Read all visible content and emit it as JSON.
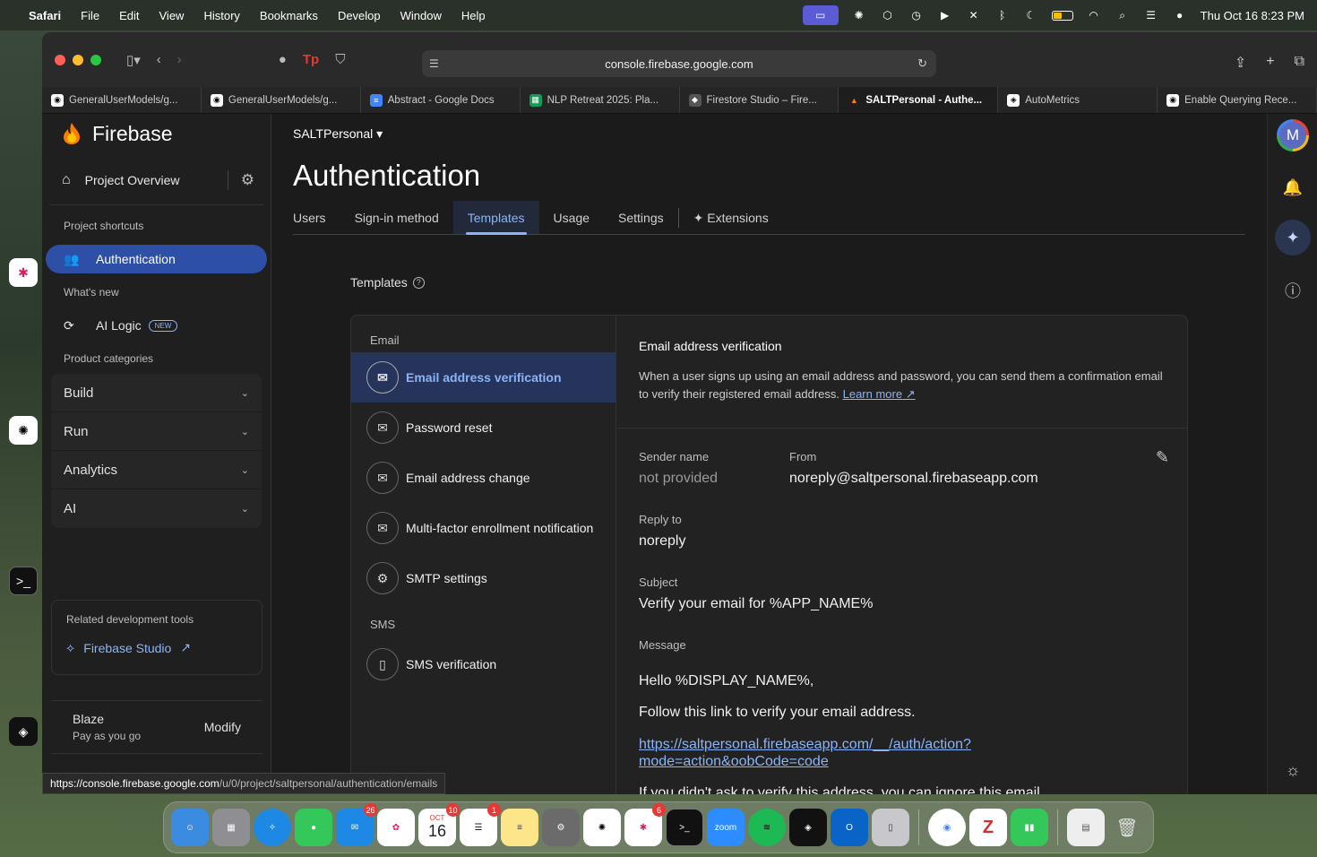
{
  "menubar": {
    "app_name": "Safari",
    "menus": [
      "File",
      "Edit",
      "View",
      "History",
      "Bookmarks",
      "Develop",
      "Window",
      "Help"
    ],
    "datetime": "Thu Oct 16  8:23 PM"
  },
  "browser": {
    "url": "console.firebase.google.com",
    "tabs": [
      {
        "label": "GeneralUserModels/g...",
        "icon": "github-icon"
      },
      {
        "label": "GeneralUserModels/g...",
        "icon": "github-icon"
      },
      {
        "label": "Abstract - Google Docs",
        "icon": "google-docs-icon"
      },
      {
        "label": "NLP Retreat 2025: Pla...",
        "icon": "google-sheets-icon"
      },
      {
        "label": "Firestore Studio – Fire...",
        "icon": "firebase-studio-icon"
      },
      {
        "label": "SALTPersonal - Authe...",
        "icon": "firebase-icon",
        "active": true
      },
      {
        "label": "AutoMetrics",
        "icon": "autometrics-icon"
      },
      {
        "label": "Enable Querying Rece...",
        "icon": "github-icon"
      }
    ],
    "status_url_prefix": "https://console.firebase.google.com",
    "status_url_rest": "/u/0/project/saltpersonal/authentication/emails"
  },
  "sidebar": {
    "brand": "Firebase",
    "project_overview": "Project Overview",
    "shortcuts_label": "Project shortcuts",
    "authentication": "Authentication",
    "whats_new_label": "What's new",
    "ai_logic": "AI Logic",
    "new_badge": "NEW",
    "categories_label": "Product categories",
    "categories": [
      "Build",
      "Run",
      "Analytics",
      "AI"
    ],
    "tools_label": "Related development tools",
    "firebase_studio": "Firebase Studio",
    "plan_name": "Blaze",
    "plan_desc": "Pay as you go",
    "modify": "Modify"
  },
  "main": {
    "project": "SALTPersonal",
    "title": "Authentication",
    "tabs": [
      "Users",
      "Sign-in method",
      "Templates",
      "Usage",
      "Settings",
      "Extensions"
    ],
    "active_tab": "Templates",
    "templates_heading": "Templates"
  },
  "templates": {
    "email_group": "Email",
    "email_items": [
      {
        "label": "Email address verification",
        "icon": "mail-icon"
      },
      {
        "label": "Password reset",
        "icon": "mail-icon"
      },
      {
        "label": "Email address change",
        "icon": "mail-icon"
      },
      {
        "label": "Multi-factor enrollment notification",
        "icon": "mail-icon"
      },
      {
        "label": "SMTP settings",
        "icon": "gear-icon"
      }
    ],
    "sms_group": "SMS",
    "sms_items": [
      {
        "label": "SMS verification",
        "icon": "phone-icon"
      }
    ]
  },
  "detail": {
    "title": "Email address verification",
    "desc": "When a user signs up using an email address and password, you can send them a confirmation email to verify their registered email address.",
    "learn_more": "Learn more",
    "sender_name_label": "Sender name",
    "sender_name": "not provided",
    "from_label": "From",
    "from": "noreply@saltpersonal.firebaseapp.com",
    "reply_to_label": "Reply to",
    "reply_to": "noreply",
    "subject_label": "Subject",
    "subject": "Verify your email for %APP_NAME%",
    "message_label": "Message",
    "message_greeting": "Hello %DISPLAY_NAME%,",
    "message_line": "Follow this link to verify your email address.",
    "message_link_1": "https://saltpersonal.firebaseapp.com/__/auth/action?",
    "message_link_2": "mode=action&oobCode=code",
    "message_tail": "If you didn't ask to verify this address, you can ignore this email."
  },
  "dock": {
    "apps": [
      "Finder",
      "Launchpad",
      "Safari",
      "Messages",
      "Mail",
      "Photos",
      "Calendar",
      "Reminders",
      "Notes",
      "System Settings",
      "ChatGPT",
      "Slack",
      "Terminal",
      "Zoom",
      "Spotify",
      "Cursor",
      "Outlook",
      "iPhone Mirroring",
      "Chrome",
      "Zotero",
      "Numbers"
    ],
    "mail_badge": "26",
    "calendar_month": "OCT",
    "calendar_day": "16",
    "calendar_badge": "10",
    "reminders_badge": "1",
    "slack_badge": "6"
  }
}
